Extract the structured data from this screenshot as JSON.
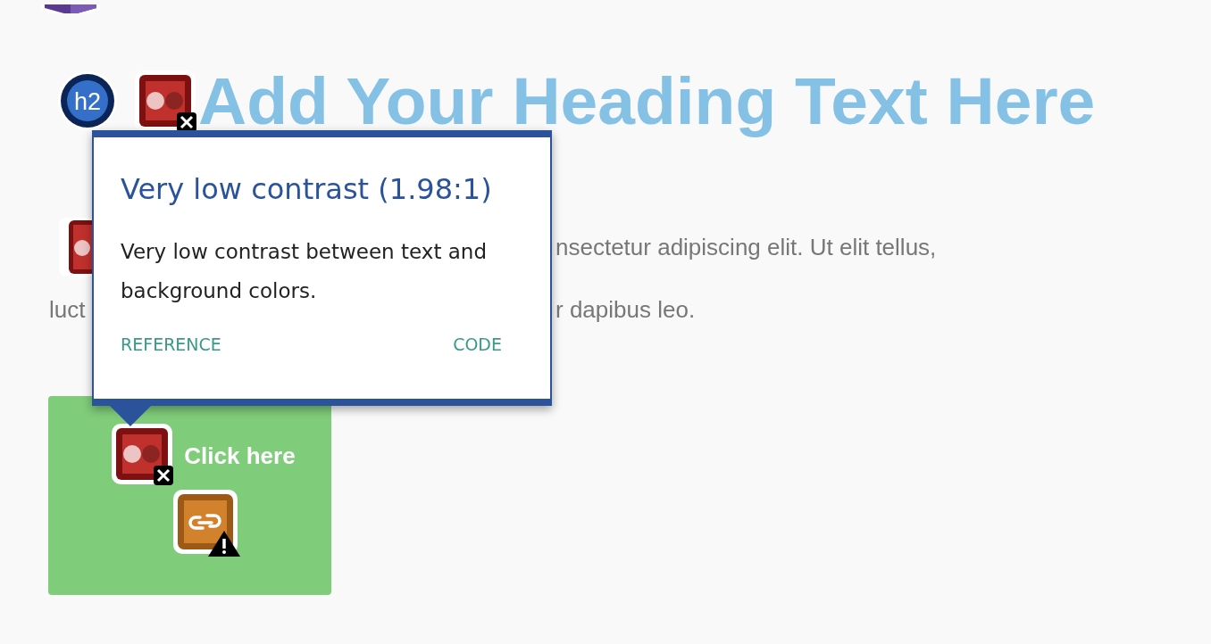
{
  "heading": {
    "level_badge": "h2",
    "text": "Add Your Heading Text Here"
  },
  "paragraph": {
    "lines": [
      {
        "right": "nsectetur adipiscing elit. Ut elit tellus,"
      },
      {
        "left": "luct",
        "right": "r dapibus leo."
      }
    ]
  },
  "button": {
    "label": "Click here"
  },
  "popup": {
    "title": "Very low contrast (1.98:1)",
    "body": "Very low contrast between text and background colors.",
    "links": [
      "REFERENCE",
      "CODE"
    ]
  }
}
